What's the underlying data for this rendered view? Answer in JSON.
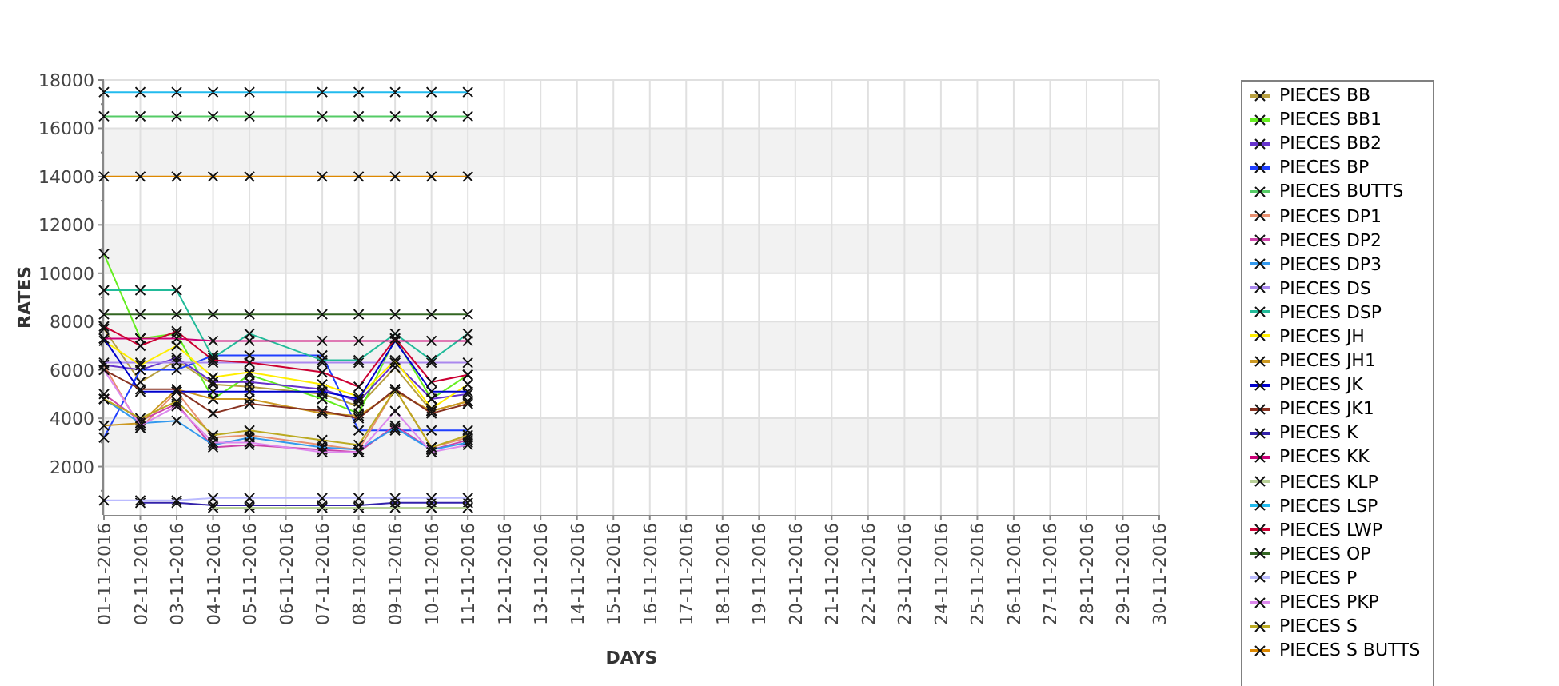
{
  "chart": {
    "chart_data": {
      "type": "line",
      "grid": true,
      "xlabel": "DAYS",
      "ylabel": "RATES",
      "categories": [
        "01-11-2016",
        "02-11-2016",
        "03-11-2016",
        "04-11-2016",
        "05-11-2016",
        "06-11-2016",
        "07-11-2016",
        "08-11-2016",
        "09-11-2016",
        "10-11-2016",
        "11-11-2016",
        "12-11-2016",
        "13-11-2016",
        "14-11-2016",
        "15-11-2016",
        "16-11-2016",
        "17-11-2016",
        "18-11-2016",
        "19-11-2016",
        "20-11-2016",
        "21-11-2016",
        "22-11-2016",
        "23-11-2016",
        "24-11-2016",
        "25-11-2016",
        "26-11-2016",
        "27-11-2016",
        "28-11-2016",
        "29-11-2016",
        "30-11-2016"
      ],
      "ylim": [
        0,
        18000
      ],
      "yticks": [
        2000,
        4000,
        6000,
        8000,
        10000,
        12000,
        14000,
        16000,
        18000
      ],
      "series": [
        {
          "name": "PIECES BB",
          "marker": "x",
          "color": "#b8a040",
          "values": [
            7700,
            5500,
            6400,
            5400,
            5300,
            null,
            5000,
            4500,
            6100,
            4300,
            4700,
            null,
            null,
            null,
            null,
            null,
            null,
            null,
            null,
            null,
            null,
            null,
            null,
            null,
            null,
            null,
            null,
            null,
            null,
            null
          ]
        },
        {
          "name": "PIECES BB1",
          "marker": "x",
          "color": "#66ee22",
          "values": [
            10800,
            7300,
            7500,
            4800,
            5800,
            null,
            4800,
            4200,
            7300,
            4800,
            5800,
            null,
            null,
            null,
            null,
            null,
            null,
            null,
            null,
            null,
            null,
            null,
            null,
            null,
            null,
            null,
            null,
            null,
            null,
            null
          ]
        },
        {
          "name": "PIECES BB2",
          "marker": "x",
          "color": "#6633cc",
          "values": [
            6200,
            6000,
            6500,
            5500,
            5500,
            null,
            5200,
            4700,
            6300,
            4800,
            5000,
            null,
            null,
            null,
            null,
            null,
            null,
            null,
            null,
            null,
            null,
            null,
            null,
            null,
            null,
            null,
            null,
            null,
            null,
            null
          ]
        },
        {
          "name": "PIECES BP",
          "marker": "x",
          "color": "#1f3fff",
          "values": [
            3200,
            6000,
            6000,
            6600,
            6600,
            null,
            6600,
            3500,
            3500,
            3500,
            3500,
            null,
            null,
            null,
            null,
            null,
            null,
            null,
            null,
            null,
            null,
            null,
            null,
            null,
            null,
            null,
            null,
            null,
            null,
            null
          ]
        },
        {
          "name": "PIECES BUTTS",
          "marker": "x",
          "color": "#55cc66",
          "values": [
            16500,
            16500,
            16500,
            16500,
            16500,
            null,
            16500,
            16500,
            16500,
            16500,
            16500,
            null,
            null,
            null,
            null,
            null,
            null,
            null,
            null,
            null,
            null,
            null,
            null,
            null,
            null,
            null,
            null,
            null,
            null,
            null
          ]
        },
        {
          "name": "PIECES DP1",
          "marker": "x",
          "color": "#e89070",
          "values": [
            6200,
            3600,
            5100,
            3200,
            3300,
            null,
            2900,
            2700,
            5200,
            2800,
            3200,
            null,
            null,
            null,
            null,
            null,
            null,
            null,
            null,
            null,
            null,
            null,
            null,
            null,
            null,
            null,
            null,
            null,
            null,
            null
          ]
        },
        {
          "name": "PIECES DP2",
          "marker": "x",
          "color": "#cc44aa",
          "values": [
            5000,
            3900,
            4600,
            2800,
            2900,
            null,
            2700,
            2600,
            3700,
            2700,
            3100,
            null,
            null,
            null,
            null,
            null,
            null,
            null,
            null,
            null,
            null,
            null,
            null,
            null,
            null,
            null,
            null,
            null,
            null,
            null
          ]
        },
        {
          "name": "PIECES DP3",
          "marker": "x",
          "color": "#3399ee",
          "values": [
            4800,
            3800,
            3900,
            2900,
            3200,
            null,
            2800,
            2700,
            3600,
            2700,
            3000,
            null,
            null,
            null,
            null,
            null,
            null,
            null,
            null,
            null,
            null,
            null,
            null,
            null,
            null,
            null,
            null,
            null,
            null,
            null
          ]
        },
        {
          "name": "PIECES DS",
          "marker": "x",
          "color": "#aa88ee",
          "values": [
            6300,
            6300,
            6300,
            6300,
            6300,
            null,
            6300,
            6300,
            6300,
            6300,
            6300,
            null,
            null,
            null,
            null,
            null,
            null,
            null,
            null,
            null,
            null,
            null,
            null,
            null,
            null,
            null,
            null,
            null,
            null,
            null
          ]
        },
        {
          "name": "PIECES DSP",
          "marker": "x",
          "color": "#22bb99",
          "values": [
            9300,
            9300,
            9300,
            6500,
            7500,
            null,
            6400,
            6400,
            7500,
            6400,
            7500,
            null,
            null,
            null,
            null,
            null,
            null,
            null,
            null,
            null,
            null,
            null,
            null,
            null,
            null,
            null,
            null,
            null,
            null,
            null
          ]
        },
        {
          "name": "PIECES JH",
          "marker": "x",
          "color": "#ffee00",
          "values": [
            7200,
            6200,
            7000,
            5700,
            5900,
            null,
            5400,
            4900,
            6400,
            4400,
            5400,
            null,
            null,
            null,
            null,
            null,
            null,
            null,
            null,
            null,
            null,
            null,
            null,
            null,
            null,
            null,
            null,
            null,
            null,
            null
          ]
        },
        {
          "name": "PIECES JH1",
          "marker": "x",
          "color": "#cc9922",
          "values": [
            3700,
            3800,
            5200,
            4800,
            4800,
            null,
            4200,
            4100,
            5100,
            4300,
            4700,
            null,
            null,
            null,
            null,
            null,
            null,
            null,
            null,
            null,
            null,
            null,
            null,
            null,
            null,
            null,
            null,
            null,
            null,
            null
          ]
        },
        {
          "name": "PIECES JK",
          "marker": "x",
          "color": "#0000cc",
          "values": [
            7300,
            5100,
            5100,
            5100,
            5100,
            null,
            5100,
            4800,
            7200,
            5100,
            5100,
            null,
            null,
            null,
            null,
            null,
            null,
            null,
            null,
            null,
            null,
            null,
            null,
            null,
            null,
            null,
            null,
            null,
            null,
            null
          ]
        },
        {
          "name": "PIECES JK1",
          "marker": "x",
          "color": "#883322",
          "values": [
            6000,
            5200,
            5200,
            4200,
            4600,
            null,
            4300,
            4000,
            5200,
            4200,
            4600,
            null,
            null,
            null,
            null,
            null,
            null,
            null,
            null,
            null,
            null,
            null,
            null,
            null,
            null,
            null,
            null,
            null,
            null,
            null
          ]
        },
        {
          "name": "PIECES K",
          "marker": "x",
          "color": "#3322aa",
          "values": [
            null,
            500,
            500,
            400,
            400,
            null,
            400,
            400,
            500,
            500,
            500,
            null,
            null,
            null,
            null,
            null,
            null,
            null,
            null,
            null,
            null,
            null,
            null,
            null,
            null,
            null,
            null,
            null,
            null,
            null
          ]
        },
        {
          "name": "PIECES KK",
          "marker": "x",
          "color": "#cc0077",
          "values": [
            7300,
            7300,
            7300,
            7200,
            7200,
            null,
            7200,
            7200,
            7200,
            7200,
            7200,
            null,
            null,
            null,
            null,
            null,
            null,
            null,
            null,
            null,
            null,
            null,
            null,
            null,
            null,
            null,
            null,
            null,
            null,
            null
          ]
        },
        {
          "name": "PIECES KLP",
          "marker": "x",
          "color": "#b8d098",
          "values": [
            null,
            null,
            null,
            300,
            300,
            null,
            300,
            300,
            300,
            300,
            300,
            null,
            null,
            null,
            null,
            null,
            null,
            null,
            null,
            null,
            null,
            null,
            null,
            null,
            null,
            null,
            null,
            null,
            null,
            null
          ]
        },
        {
          "name": "PIECES LSP",
          "marker": "x",
          "color": "#22bbee",
          "values": [
            17500,
            17500,
            17500,
            17500,
            17500,
            null,
            17500,
            17500,
            17500,
            17500,
            17500,
            null,
            null,
            null,
            null,
            null,
            null,
            null,
            null,
            null,
            null,
            null,
            null,
            null,
            null,
            null,
            null,
            null,
            null,
            null
          ]
        },
        {
          "name": "PIECES LWP",
          "marker": "x",
          "color": "#cc0033",
          "values": [
            7800,
            7000,
            7600,
            6400,
            6300,
            null,
            5900,
            5300,
            7300,
            5500,
            5800,
            null,
            null,
            null,
            null,
            null,
            null,
            null,
            null,
            null,
            null,
            null,
            null,
            null,
            null,
            null,
            null,
            null,
            null,
            null
          ]
        },
        {
          "name": "PIECES OP",
          "marker": "x",
          "color": "#336622",
          "values": [
            8300,
            8300,
            8300,
            8300,
            8300,
            null,
            8300,
            8300,
            8300,
            8300,
            8300,
            null,
            null,
            null,
            null,
            null,
            null,
            null,
            null,
            null,
            null,
            null,
            null,
            null,
            null,
            null,
            null,
            null,
            null,
            null
          ]
        },
        {
          "name": "PIECES P",
          "marker": "x",
          "color": "#bbbbff",
          "values": [
            600,
            600,
            600,
            700,
            700,
            null,
            700,
            700,
            700,
            700,
            700,
            null,
            null,
            null,
            null,
            null,
            null,
            null,
            null,
            null,
            null,
            null,
            null,
            null,
            null,
            null,
            null,
            null,
            null,
            null
          ]
        },
        {
          "name": "PIECES PKP",
          "marker": "x",
          "color": "#dd88ee",
          "values": [
            6000,
            3700,
            4500,
            3000,
            3000,
            null,
            2600,
            2600,
            4300,
            2600,
            2900,
            null,
            null,
            null,
            null,
            null,
            null,
            null,
            null,
            null,
            null,
            null,
            null,
            null,
            null,
            null,
            null,
            null,
            null,
            null
          ]
        },
        {
          "name": "PIECES S",
          "marker": "x",
          "color": "#bbaa22",
          "values": [
            4800,
            4000,
            4700,
            3300,
            3500,
            null,
            3100,
            2900,
            5200,
            2800,
            3300,
            null,
            null,
            null,
            null,
            null,
            null,
            null,
            null,
            null,
            null,
            null,
            null,
            null,
            null,
            null,
            null,
            null,
            null,
            null
          ]
        },
        {
          "name": "PIECES S BUTTS",
          "marker": "x",
          "color": "#dd8800",
          "values": [
            14000,
            14000,
            14000,
            14000,
            14000,
            null,
            14000,
            14000,
            14000,
            14000,
            14000,
            null,
            null,
            null,
            null,
            null,
            null,
            null,
            null,
            null,
            null,
            null,
            null,
            null,
            null,
            null,
            null,
            null,
            null,
            null
          ]
        }
      ]
    }
  }
}
